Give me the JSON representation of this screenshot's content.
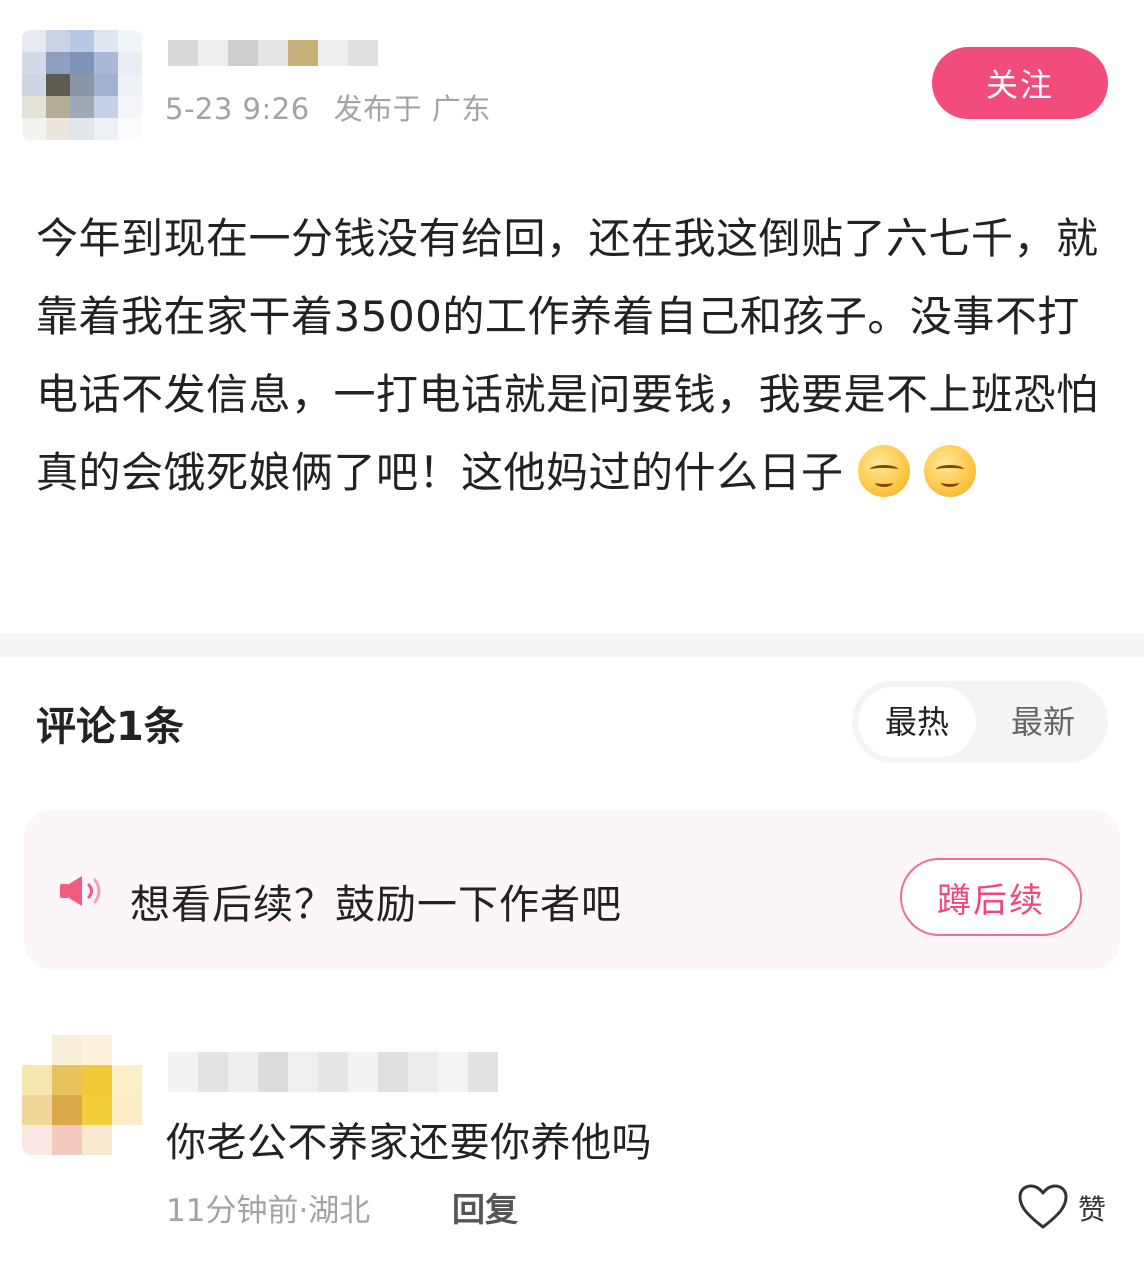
{
  "post": {
    "timestamp": "5-23 9:26",
    "location_prefix": "发布于",
    "location": "广东",
    "follow_label": "关注",
    "content": "今年到现在一分钱没有给回，还在我这倒贴了六七千，就靠着我在家干着3500的工作养着自己和孩子。没事不打电话不发信息，一打电话就是问要钱，我要是不上班恐怕真的会饿死娘俩了吧！这他妈过的什么日子",
    "emojis": [
      "smirk-emoji",
      "smirk-emoji"
    ]
  },
  "comments_section": {
    "title": "评论1条",
    "sort_options": [
      {
        "label": "最热",
        "active": true
      },
      {
        "label": "最新",
        "active": false
      }
    ]
  },
  "banner": {
    "text": "想看后续？鼓励一下作者吧",
    "button_label": "蹲后续",
    "icon": "speaker-icon",
    "accent_color": "#f0467a"
  },
  "comment": {
    "text": "你老公不养家还要你养他吗",
    "time_location": "11分钟前·湖北",
    "reply_label": "回复",
    "like_label": "赞",
    "like_icon": "heart-outline-icon"
  },
  "colors": {
    "follow_button": "#f24c7c",
    "banner_bg": "#fdf6f8",
    "meta_text": "#a3a3a3"
  }
}
